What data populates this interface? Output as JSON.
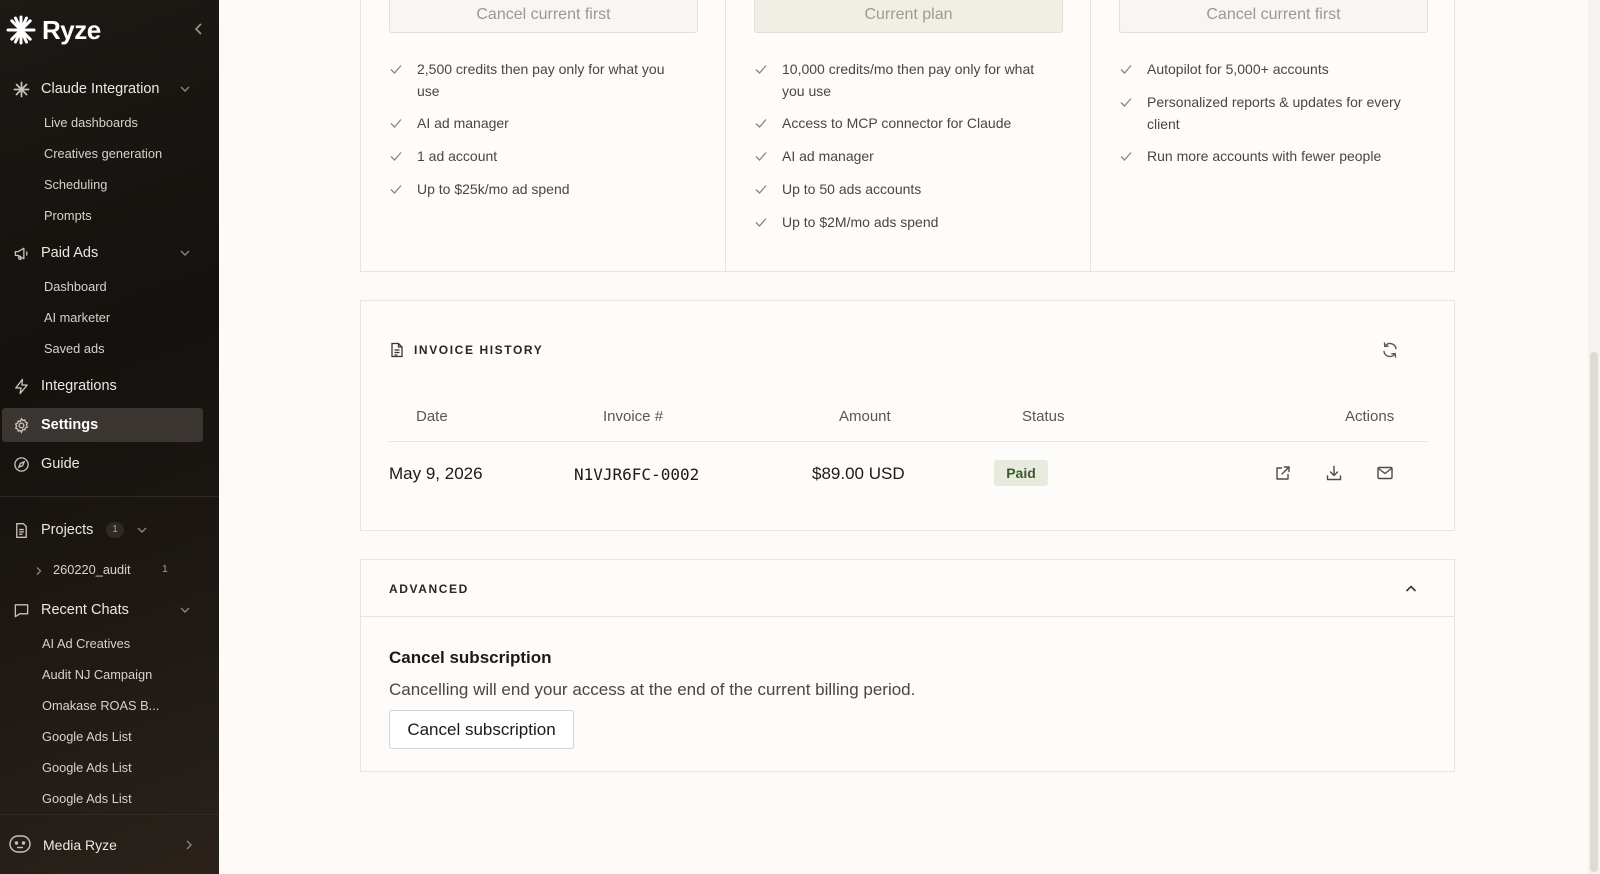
{
  "app": {
    "brand": "Ryze"
  },
  "sidebar": {
    "sections": {
      "claude": {
        "label": "Claude Integration",
        "items": [
          "Live dashboards",
          "Creatives generation",
          "Scheduling",
          "Prompts"
        ]
      },
      "paid_ads": {
        "label": "Paid Ads",
        "items": [
          "Dashboard",
          "AI marketer",
          "Saved ads"
        ]
      },
      "integrations": {
        "label": "Integrations"
      },
      "settings": {
        "label": "Settings"
      },
      "guide": {
        "label": "Guide"
      },
      "projects": {
        "label": "Projects",
        "count": "1",
        "items": [
          {
            "name": "260220_audit",
            "count": "1"
          }
        ]
      },
      "recent_chats": {
        "label": "Recent Chats",
        "items": [
          "AI Ad Creatives",
          "Audit NJ Campaign",
          "Omakase ROAS B...",
          "Google Ads List",
          "Google Ads List",
          "Google Ads List"
        ]
      }
    },
    "account": {
      "name": "Media Ryze"
    }
  },
  "plans": [
    {
      "button": "Cancel current first",
      "features": [
        "2,500 credits then pay only for what you use",
        "AI ad manager",
        "1 ad account",
        "Up to $25k/mo ad spend"
      ]
    },
    {
      "button": "Current plan",
      "features": [
        "10,000 credits/mo then pay only for what you use",
        "Access to MCP connector for Claude",
        "AI ad manager",
        "Up to 50 ads accounts",
        "Up to $2M/mo ads spend"
      ]
    },
    {
      "button": "Cancel current first",
      "features": [
        "Autopilot for 5,000+ accounts",
        "Personalized reports & updates for every client",
        "Run more accounts with fewer people"
      ]
    }
  ],
  "invoice_history": {
    "title": "INVOICE HISTORY",
    "columns": [
      "Date",
      "Invoice #",
      "Amount",
      "Status",
      "Actions"
    ],
    "rows": [
      {
        "date": "May 9, 2026",
        "invoice": "N1VJR6FC-0002",
        "amount": "$89.00 USD",
        "status": "Paid"
      }
    ]
  },
  "advanced": {
    "title": "ADVANCED",
    "cancel_heading": "Cancel subscription",
    "cancel_description": "Cancelling will end your access at the end of the current billing period.",
    "cancel_button": "Cancel subscription"
  },
  "colors": {
    "sidebar_bg": "#17130f",
    "page_bg": "#fcfbf8",
    "paid_badge_bg": "#e7eadd",
    "paid_badge_text": "#3d5a2e"
  }
}
